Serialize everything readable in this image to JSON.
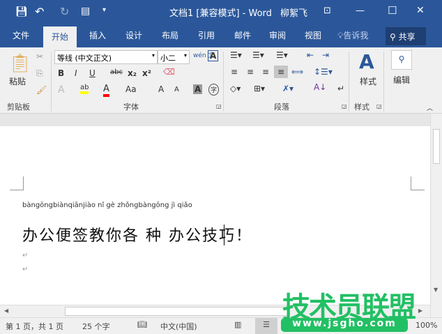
{
  "title_bar": {
    "title": "文档1 [兼容模式]  -  Word",
    "user": "柳絮飞",
    "save_icon": "save-icon",
    "undo_icon": "undo-icon",
    "redo_icon": "redo-icon",
    "touch_icon": "touch-mode-icon",
    "qat_more": "▾",
    "ribbon_display": "⊡",
    "minimize": "—",
    "maximize": "☐",
    "close": "✕"
  },
  "tabs": [
    {
      "label": "文件"
    },
    {
      "label": "开始",
      "active": true
    },
    {
      "label": "插入"
    },
    {
      "label": "设计"
    },
    {
      "label": "布局"
    },
    {
      "label": "引用"
    },
    {
      "label": "邮件"
    },
    {
      "label": "审阅"
    },
    {
      "label": "视图"
    },
    {
      "label": "告诉我"
    }
  ],
  "share": "共享",
  "ribbon": {
    "clipboard": {
      "paste": "粘贴",
      "group": "剪贴板"
    },
    "font": {
      "font_name": "等线 (中文正文)",
      "font_size": "小二",
      "pinyin_guide": "wén 文",
      "bold": "B",
      "italic": "I",
      "underline": "U",
      "strike": "abc",
      "subscript": "x₂",
      "superscript": "x²",
      "text_effect": "A",
      "highlight": "ab",
      "font_color": "A",
      "change_case": "Aa",
      "grow": "A",
      "shrink": "A",
      "char_shading": "A",
      "enclose": "字",
      "group": "字体"
    },
    "paragraph": {
      "group": "段落"
    },
    "styles": {
      "label": "样式",
      "group": "样式"
    },
    "editing": {
      "label": "编辑"
    }
  },
  "document": {
    "pinyin": "bàngōngbiànqiānjiào  nǐ  gè zhǒngbàngōng  jì  qiǎo",
    "text": "办公便签教你各 种 办公技巧！",
    "para_mark": "↵"
  },
  "status": {
    "page": "第 1 页，共 1 页",
    "words": "25 个字",
    "language": "中文(中国)",
    "zoom": "100%"
  },
  "watermark": {
    "text": "技术员联盟",
    "url": "www.jsgho.com",
    "color": "#22c064"
  },
  "colors": {
    "accent": "#2b579a",
    "highlight": "#ffff00",
    "font_color": "#ff0000"
  }
}
